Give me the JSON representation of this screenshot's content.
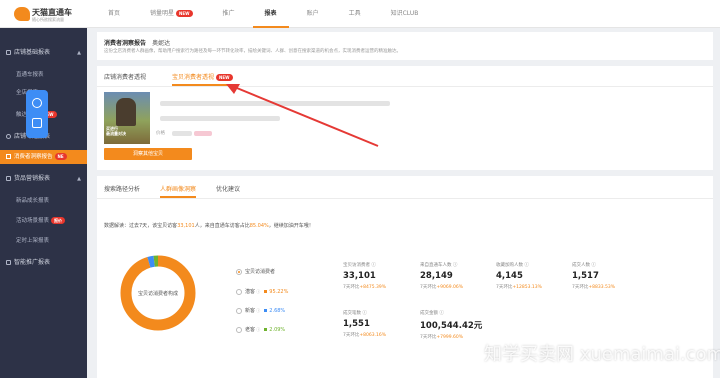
{
  "app": {
    "name": "天猫直通车",
    "tagline": "随心所欲搜索流量"
  },
  "top_nav": [
    {
      "label": "首页"
    },
    {
      "label": "销量明星",
      "badge": "NEW"
    },
    {
      "label": "推广"
    },
    {
      "label": "报表",
      "active": true
    },
    {
      "label": "账户"
    },
    {
      "label": "工具"
    },
    {
      "label": "知识CLUB"
    }
  ],
  "sidebar": {
    "groups": [
      {
        "label": "店铺基础报表"
      },
      {
        "label": "店铺专题报表"
      },
      {
        "label": "消费者洞察报告",
        "badge": "NE",
        "active": true
      },
      {
        "label": "货品营销报表"
      },
      {
        "label": "智能推广报表"
      }
    ],
    "items": [
      {
        "label": "直通车报表"
      },
      {
        "label": "全店报表"
      },
      {
        "label": "触达报表",
        "badge": "NEW"
      },
      {
        "label": "新品成长报表"
      },
      {
        "label": "活动场景报表",
        "badge": "报价"
      },
      {
        "label": "定时上架报表"
      }
    ]
  },
  "header": {
    "title": "消费者洞察报告",
    "title_suffix": "奥妮达",
    "desc": "这份全店消费者人群画像，帮助用户搜索行为路径及每一环节转化效率，描绘关键词、人群、创意在搜索渠道的机会点，实现消费者运营的精准触达。"
  },
  "report_tabs": [
    {
      "label": "店铺消费者透视"
    },
    {
      "label": "宝贝消费者透视",
      "badge": "NEW",
      "active": true
    }
  ],
  "product": {
    "caption": "买进行\n最流量对决",
    "button": "洞察其他宝贝",
    "price_prefix": "价格"
  },
  "analysis_tabs": [
    {
      "label": "搜索路径分析"
    },
    {
      "label": "人群画像洞察",
      "active": true
    },
    {
      "label": "优化建议"
    }
  ],
  "notice": {
    "prefix": "数据解读：过去7天，该宝贝访客",
    "visitors": "33,101",
    "middle": "人，来自直通车访客占比",
    "ratio": "85.04%",
    "suffix": "，继续加油开车哦！"
  },
  "donut": {
    "center_label": "宝贝访消费者构成",
    "segments": [
      {
        "name": "潜客",
        "percent": 95.22,
        "color": "#f38a1d"
      },
      {
        "name": "新客",
        "percent": 2.68,
        "color": "#3d8df5"
      },
      {
        "name": "老客",
        "percent": 2.09,
        "color": "#6fb32e"
      }
    ]
  },
  "options": [
    {
      "label": "宝贝访消费者",
      "selected": true
    },
    {
      "label": "潜客",
      "icon": "help-icon",
      "value": "95.22%",
      "color": "#f38a1d"
    },
    {
      "label": "新客",
      "icon": "help-icon",
      "value": "2.68%",
      "color": "#3d8df5"
    },
    {
      "label": "老客",
      "icon": "help-icon",
      "value": "2.09%",
      "color": "#6fb32e"
    }
  ],
  "metrics": [
    {
      "label": "宝贝访消费者",
      "value": "33,101",
      "cmp_prefix": "7天环比",
      "cmp": "+8475.39%"
    },
    {
      "label": "来自直通车人数",
      "value": "28,149",
      "cmp_prefix": "7天环比",
      "cmp": "+9069.06%"
    },
    {
      "label": "收藏加购人数",
      "value": "4,145",
      "cmp_prefix": "7天环比",
      "cmp": "+12853.13%"
    },
    {
      "label": "成交人数",
      "value": "1,517",
      "cmp_prefix": "7天环比",
      "cmp": "+8833.53%"
    },
    {
      "label": "成交笔数",
      "value": "1,551",
      "cmp_prefix": "7天环比",
      "cmp": "+8063.16%"
    },
    {
      "label": "成交金额",
      "value": "100,544.42元",
      "cmp_prefix": "7天环比",
      "cmp": "+7999.60%"
    }
  ],
  "watermark": "知学买卖网 xuemaimai.com",
  "colors": {
    "accent": "#f38a1d",
    "sidebar_bg": "#2d3247",
    "annotation_arrow": "#e53935"
  }
}
